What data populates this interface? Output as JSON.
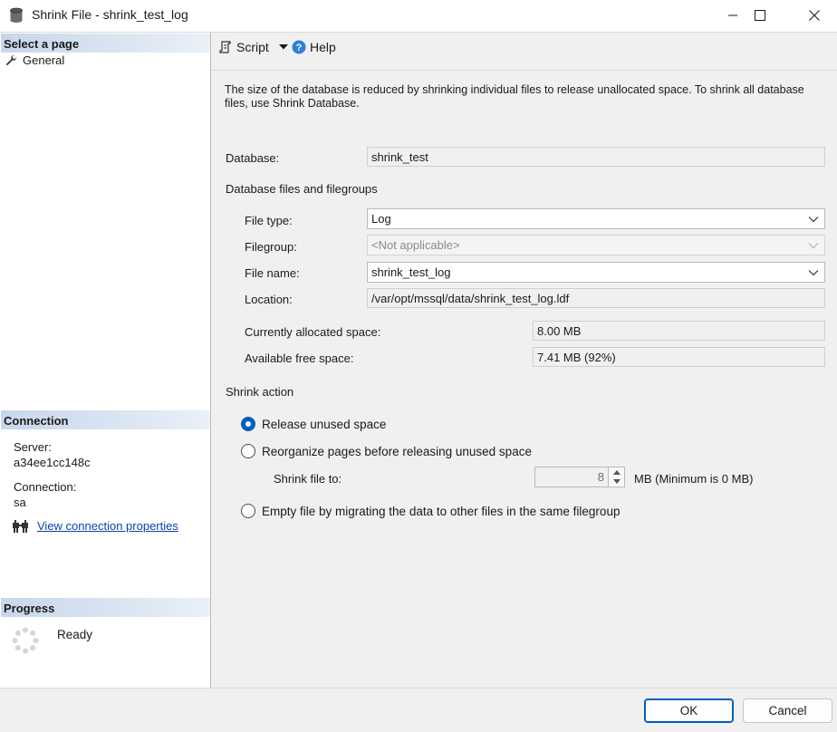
{
  "window": {
    "title": "Shrink File - shrink_test_log"
  },
  "left": {
    "select_page_header": "Select a page",
    "pages": [
      {
        "label": "General"
      }
    ],
    "connection_header": "Connection",
    "server_label": "Server:",
    "server_value": "a34ee1cc148c",
    "connection_label": "Connection:",
    "connection_value": "sa",
    "view_connection_link": "View connection properties",
    "progress_header": "Progress",
    "progress_status": "Ready"
  },
  "toolbar": {
    "script_label": "Script",
    "help_label": "Help"
  },
  "main": {
    "description": "The size of the database is reduced by shrinking individual files to release unallocated space. To shrink all database files, use Shrink Database.",
    "database_label": "Database:",
    "database_value": "shrink_test",
    "files_group_label": "Database files and filegroups",
    "file_type_label": "File type:",
    "file_type_value": "Log",
    "filegroup_label": "Filegroup:",
    "filegroup_value": "<Not applicable>",
    "file_name_label": "File name:",
    "file_name_value": "shrink_test_log",
    "location_label": "Location:",
    "location_value": "/var/opt/mssql/data/shrink_test_log.ldf",
    "allocated_label": "Currently allocated space:",
    "allocated_value": "8.00 MB",
    "free_label": "Available free space:",
    "free_value": "7.41 MB (92%)",
    "shrink_action_label": "Shrink action",
    "radio_release": "Release unused space",
    "radio_reorganize": "Reorganize pages before releasing unused space",
    "shrink_to_label": "Shrink file to:",
    "shrink_to_value": "8",
    "shrink_to_unit": "MB (Minimum is 0 MB)",
    "radio_empty": "Empty file by migrating the data to other files in the same filegroup"
  },
  "footer": {
    "ok_label": "OK",
    "cancel_label": "Cancel"
  },
  "colors": {
    "accent": "#005fb8",
    "link": "#0645ad",
    "panel_bg": "#f0f0f0",
    "header_gradient_start": "#c7d7ea"
  }
}
